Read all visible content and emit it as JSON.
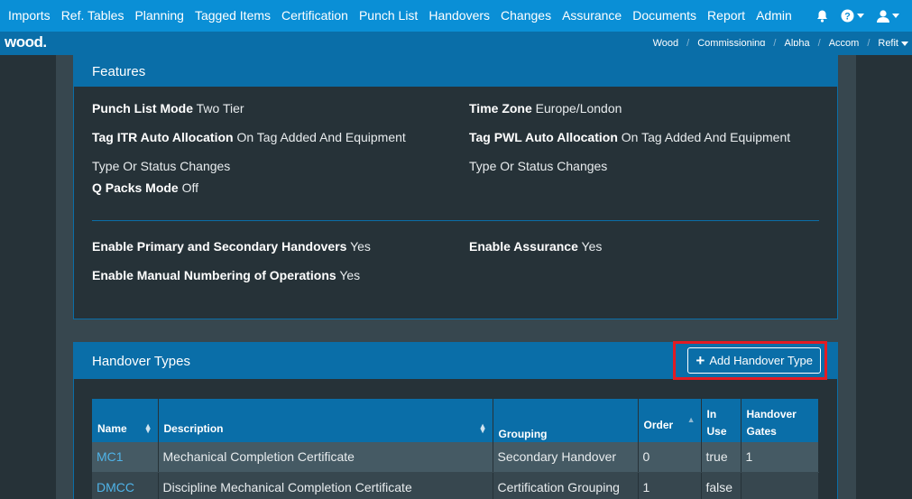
{
  "topnav": {
    "items": [
      "Imports",
      "Ref. Tables",
      "Planning",
      "Tagged Items",
      "Certification",
      "Punch List",
      "Handovers",
      "Changes",
      "Assurance",
      "Documents",
      "Report",
      "Admin"
    ],
    "icons": [
      "bell-icon",
      "help-icon",
      "user-icon"
    ]
  },
  "subnav": {
    "logo": "wood.",
    "breadcrumbs": [
      "Wood",
      "Commissioning",
      "Alpha",
      "Accom",
      "Refit"
    ]
  },
  "features": {
    "title": "Features",
    "punch_list_mode": {
      "label": "Punch List Mode",
      "value": "Two Tier"
    },
    "time_zone": {
      "label": "Time Zone",
      "value": "Europe/London"
    },
    "tag_itr": {
      "label": "Tag ITR Auto Allocation",
      "value": "On Tag Added And Equipment",
      "value_cont": "Type Or Status Changes"
    },
    "tag_pwl": {
      "label": "Tag PWL Auto Allocation",
      "value": "On Tag Added And Equipment",
      "value_cont": "Type Or Status Changes"
    },
    "q_packs": {
      "label": "Q Packs Mode",
      "value": "Off"
    },
    "primary_secondary": {
      "label": "Enable Primary and Secondary Handovers",
      "value": "Yes"
    },
    "assurance": {
      "label": "Enable Assurance",
      "value": "Yes"
    },
    "manual_numbering": {
      "label": "Enable Manual Numbering of Operations",
      "value": "Yes"
    }
  },
  "handover_types": {
    "title": "Handover Types",
    "add_button": "Add Handover Type",
    "columns": [
      "Name",
      "Description",
      "Grouping",
      "Order",
      "In Use",
      "Handover Gates"
    ],
    "rows": [
      {
        "name": "MC1",
        "description": "Mechanical Completion Certificate",
        "grouping": "Secondary Handover",
        "order": "0",
        "in_use": "true",
        "gates": "1"
      },
      {
        "name": "DMCC",
        "description": "Discipline Mechanical Completion Certificate",
        "grouping": "Certification Grouping",
        "order": "1",
        "in_use": "false",
        "gates": ""
      }
    ]
  },
  "colors": {
    "nav": "#0a8fd6",
    "subnav": "#0a6ea8",
    "background": "#263238",
    "highlight": "#e31b23"
  }
}
